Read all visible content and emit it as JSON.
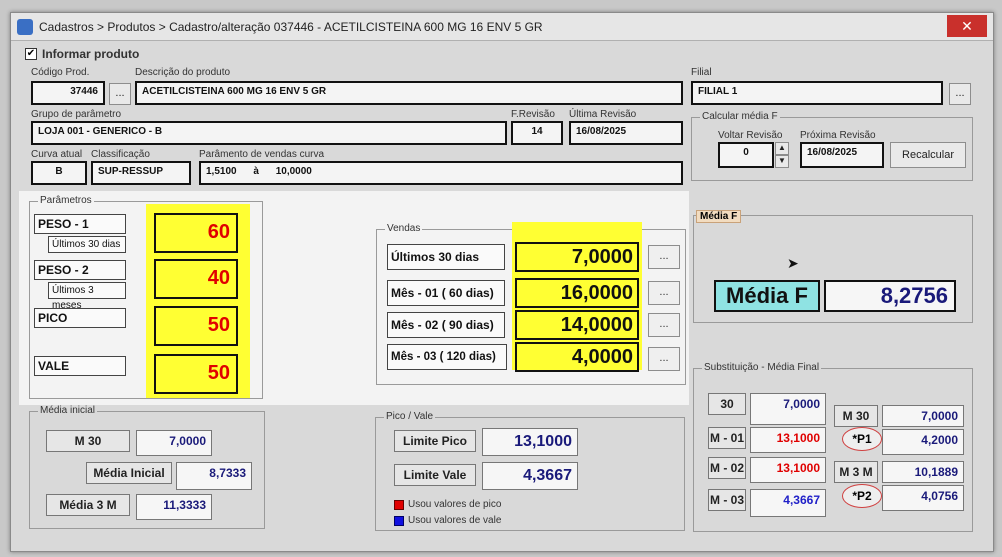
{
  "window": {
    "title": "Cadastros > Produtos > Cadastro/alteração  037446 - ACETILCISTEINA 600 MG 16 ENV 5 GR",
    "close": "✕"
  },
  "informar": {
    "label": "Informar produto"
  },
  "codigo": {
    "label": "Código Prod.",
    "value": "37446"
  },
  "descricao": {
    "label": "Descrição do  produto",
    "value": "ACETILCISTEINA 600 MG 16 ENV 5 GR"
  },
  "filial": {
    "label": "Filial",
    "value": "FILIAL 1"
  },
  "grupo": {
    "label": "Grupo de parâmetro",
    "value": "LOJA 001 - GENERICO - B"
  },
  "frevisao": {
    "label": "F.Revisão",
    "value": "14"
  },
  "ultima": {
    "label": "Última Revisão",
    "value": "16/08/2025"
  },
  "curva": {
    "label": "Curva atual",
    "value": "B"
  },
  "classificacao": {
    "label": "Classificação",
    "value": "SUP-RESSUP"
  },
  "paramcurva": {
    "label": "Parâmento de vendas curva",
    "from": "1,5100",
    "sep": "à",
    "to": "10,0000"
  },
  "calcular": {
    "label": "Calcular média F",
    "voltar_label": "Voltar Revisão",
    "voltar_value": "0",
    "proxima_label": "Próxima Revisão",
    "proxima_value": "16/08/2025",
    "recalcular": "Recalcular"
  },
  "parametros": {
    "label": "Parâmetros",
    "peso1": "PESO - 1",
    "peso1_sub": "Últimos 30 dias",
    "peso1_value": "60",
    "peso2": "PESO - 2",
    "peso2_sub": "Últimos 3 meses",
    "peso2_value": "40",
    "pico": "PICO",
    "pico_value": "50",
    "vale": "VALE",
    "vale_value": "50"
  },
  "vendas": {
    "label": "Vendas",
    "rows": [
      {
        "label": "Últimos 30 dias",
        "value": "7,0000"
      },
      {
        "label": "Mês - 01 ( 60 dias)",
        "value": "16,0000"
      },
      {
        "label": "Mês - 02 ( 90 dias)",
        "value": "14,0000"
      },
      {
        "label": "Mês - 03 ( 120 dias)",
        "value": "4,0000"
      }
    ],
    "dots": "..."
  },
  "mediaf": {
    "label": "Média F",
    "tag": "Média F",
    "value": "8,2756"
  },
  "substituicao": {
    "label": "Substituição - Média Final",
    "r1_tag": "30",
    "r1_value": "7,0000",
    "r2_tag": "M - 01",
    "r2_value": "13,1000",
    "r3_tag": "M - 02",
    "r3_value": "13,1000",
    "r4_tag": "M - 03",
    "r4_value": "4,3667",
    "m30_tag": "M 30",
    "m30_value": "7,0000",
    "p1_tag": "*P1",
    "p1_value": "4,2000",
    "m3m_tag": "M 3 M",
    "m3m_value": "10,1889",
    "p2_tag": "*P2",
    "p2_value": "4,0756"
  },
  "mediainicial": {
    "label": "Média inicial",
    "m30_tag": "M 30",
    "m30_value": "7,0000",
    "mi_tag": "Média Inicial",
    "mi_value": "8,7333",
    "m3m_tag": "Média 3 M",
    "m3m_value": "11,3333"
  },
  "picovale": {
    "label": "Pico / Vale",
    "lp_tag": "Limite Pico",
    "lp_value": "13,1000",
    "lv_tag": "Limite Vale",
    "lv_value": "4,3667",
    "leg_pico": "Usou valores de pico",
    "leg_vale": "Usou valores de vale"
  },
  "colors": {
    "yellow": "#ffff33",
    "red": "#e00000",
    "blue": "#1a1a7a",
    "teal": "#8fe3e3"
  }
}
